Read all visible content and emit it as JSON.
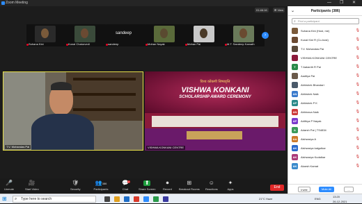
{
  "window": {
    "title": "Zoom Meeting",
    "controls": [
      "—",
      "❐",
      "✕"
    ]
  },
  "stage": {
    "top_badges": {
      "timer": "01:46:16",
      "view": "⊞ View"
    },
    "thumbnails": [
      {
        "name": "Suhana Kini",
        "color": "#7a5a3a",
        "bg": "#2a2a2a"
      },
      {
        "name": "Kunal Chaturvedi",
        "color": "#6b4a32",
        "bg": "#3a4a3a"
      },
      {
        "name": "sandeep",
        "color": "#111111",
        "bg": "#111111",
        "text": "sandeep"
      },
      {
        "name": "Mohan Nayak",
        "color": "#5a4a30",
        "bg": "#5a6a3a"
      },
      {
        "name": "Mohan Pai",
        "color": "#4a3a28",
        "bg": "#c9c9c9"
      },
      {
        "name": "M.T. Sandeep Kamath",
        "color": "#6a4a30",
        "bg": "#6a7a5a"
      }
    ],
    "next_icon": "›",
    "video1_label": "T.V. Mohandas Pai",
    "video2_label": "VISHWA KONKANI CENTRE",
    "video2_title_devanagari": "विश्व कोंकणी शिष्यवृत्ति",
    "video2_title_main": "VISHWA KONKANI",
    "video2_title_sub": "SCHOLARSHIP AWARD CEREMONY"
  },
  "toolbar": {
    "items": [
      {
        "label": "Unmute",
        "icon": "🎤"
      },
      {
        "label": "Start Video",
        "icon": "🎥"
      },
      {
        "label": "Security",
        "icon": "🛡"
      },
      {
        "label": "Participants",
        "icon": "👥",
        "count": "386"
      },
      {
        "label": "Chat",
        "icon": "💬",
        "count": "2"
      },
      {
        "label": "Share Screen",
        "icon": "⬆"
      },
      {
        "label": "Record",
        "icon": "⏺"
      },
      {
        "label": "Breakout Rooms",
        "icon": "⊞"
      },
      {
        "label": "Reactions",
        "icon": "☺"
      },
      {
        "label": "Apps",
        "icon": "✦"
      }
    ],
    "end_label": "End"
  },
  "participants": {
    "header": "Participants (386)",
    "search_placeholder": "Find a participant",
    "list": [
      {
        "initials": "",
        "name": "Suhana Kini (Host, me)",
        "color": "#7a5a3a"
      },
      {
        "initials": "",
        "name": "Kunal Kini R (Co-host)",
        "color": "#6b4a32"
      },
      {
        "initials": "",
        "name": "T.V. Mohandas Pai",
        "color": "#5a4a3a"
      },
      {
        "initials": "",
        "name": "VISHWA KONKANI CENTRE",
        "color": "#8b1a3a"
      },
      {
        "initials": "T",
        "name": "T Aakanth R Pai",
        "color": "#2a8a4a"
      },
      {
        "initials": "",
        "name": "Aaditya Pai",
        "color": "#6a5a4a"
      },
      {
        "initials": "",
        "name": "Abhishek Bhandari",
        "color": "#4a5a6a"
      },
      {
        "initials": "AN",
        "name": "Abhishek Naik",
        "color": "#3a7acc"
      },
      {
        "initials": "AP",
        "name": "Abhishek P K",
        "color": "#2a8a8a"
      },
      {
        "initials": "AN",
        "name": "Abhinava Naik",
        "color": "#cc3a3a"
      },
      {
        "initials": "AP",
        "name": "Adithya P Nayak",
        "color": "#7a3acc"
      },
      {
        "initials": "A",
        "name": "Adarsh Pai | TS4834",
        "color": "#3a9a5a"
      },
      {
        "initials": "AA",
        "name": "Aishwarya A",
        "color": "#cc7a2a"
      },
      {
        "initials": "AK",
        "name": "Aishwarya kalgutkar",
        "color": "#2a6acc"
      },
      {
        "initials": "AK",
        "name": "Aishwarya Kudalkar",
        "color": "#aa3a7a"
      },
      {
        "initials": "AK",
        "name": "Akarsh Kamat",
        "color": "#3a8acc"
      }
    ],
    "invite_label": "Invite",
    "mute_all_label": "Mute All",
    "more_label": "..."
  },
  "taskbar": {
    "search_placeholder": "Type here to search",
    "weather": "21°C Haze",
    "time": "13:20",
    "date": "26-12-2021",
    "lang": "ENG"
  }
}
